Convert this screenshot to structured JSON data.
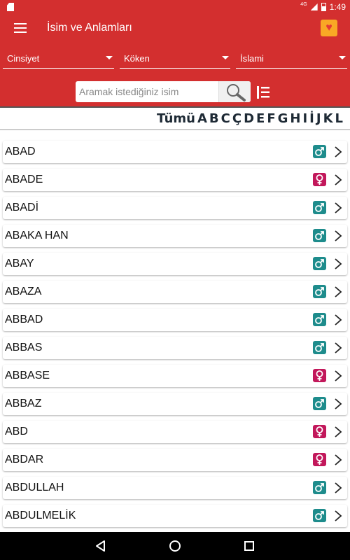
{
  "status": {
    "network": "4G",
    "time": "1:49"
  },
  "toolbar": {
    "title": "İsim ve Anlamları",
    "menu_icon": "hamburger-menu-icon",
    "app_icon": "heart-app-icon"
  },
  "filters": {
    "gender": "Cinsiyet",
    "origin": "Köken",
    "religion": "İslami"
  },
  "search": {
    "placeholder": "Aramak istediğiniz isim",
    "value": ""
  },
  "alphabet": [
    "Tümü",
    "A",
    "B",
    "C",
    "Ç",
    "D",
    "E",
    "F",
    "G",
    "H",
    "I",
    "İ",
    "J",
    "K",
    "L"
  ],
  "names": [
    {
      "name": "ABAD",
      "gender": "male"
    },
    {
      "name": "ABADE",
      "gender": "female"
    },
    {
      "name": "ABADİ",
      "gender": "male"
    },
    {
      "name": "ABAKA HAN",
      "gender": "male"
    },
    {
      "name": "ABAY",
      "gender": "male"
    },
    {
      "name": "ABAZA",
      "gender": "male"
    },
    {
      "name": "ABBAD",
      "gender": "male"
    },
    {
      "name": "ABBAS",
      "gender": "male"
    },
    {
      "name": "ABBASE",
      "gender": "female"
    },
    {
      "name": "ABBAZ",
      "gender": "male"
    },
    {
      "name": "ABD",
      "gender": "female"
    },
    {
      "name": "ABDAR",
      "gender": "female"
    },
    {
      "name": "ABDULLAH",
      "gender": "male"
    },
    {
      "name": "ABDULMELİK",
      "gender": "male"
    }
  ],
  "colors": {
    "primary": "#d32f2f",
    "male": "#1e8c8c",
    "female": "#c2185b"
  }
}
